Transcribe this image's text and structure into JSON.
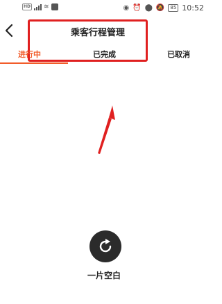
{
  "status_bar": {
    "network_label": "HD",
    "battery": "85",
    "time": "10:52"
  },
  "header": {
    "title": "乘客行程管理"
  },
  "tabs": [
    {
      "label": "进行中",
      "active": true
    },
    {
      "label": "已完成",
      "active": false
    },
    {
      "label": "已取消",
      "active": false
    }
  ],
  "empty_state": {
    "text": "一片空白"
  },
  "colors": {
    "accent": "#f25c2a",
    "annotation": "#e02020"
  }
}
